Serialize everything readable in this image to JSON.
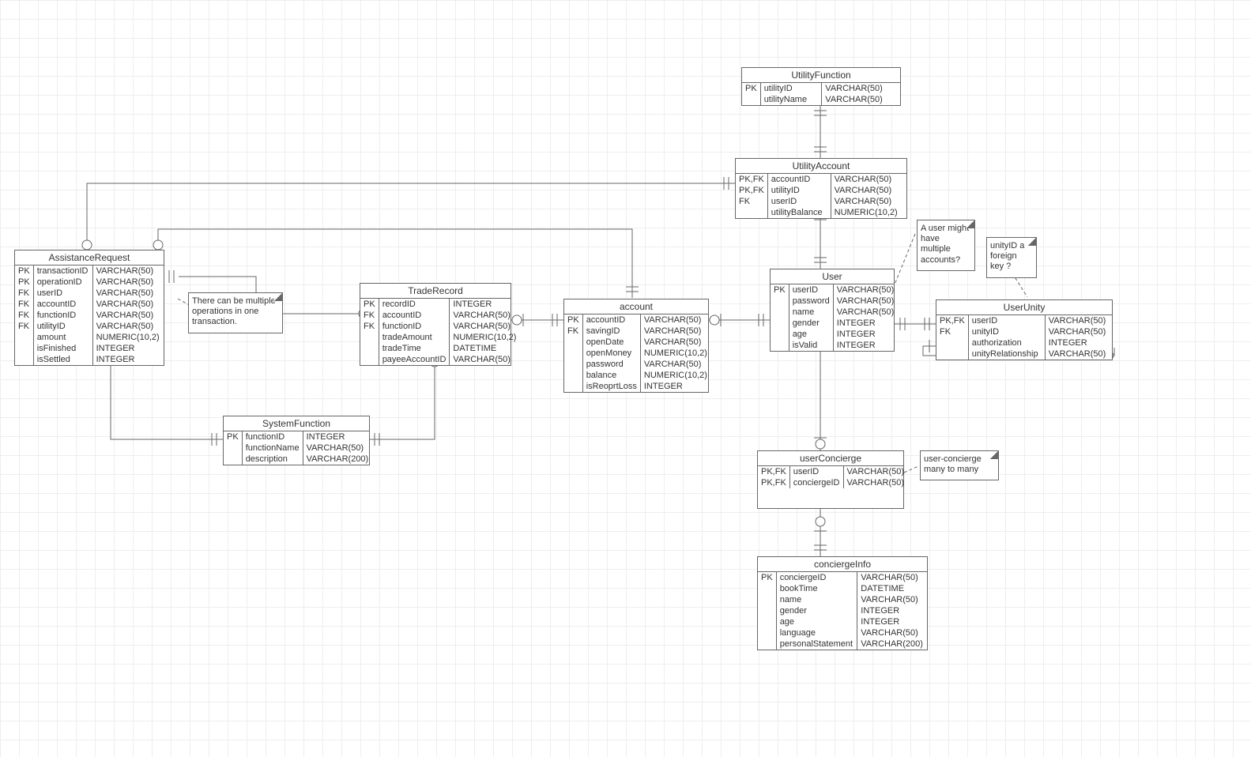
{
  "entities": {
    "utilityFunction": {
      "title": "UtilityFunction",
      "rows": [
        {
          "k": "PK",
          "f": "utilityID",
          "t": "VARCHAR(50)"
        },
        {
          "k": "",
          "f": "utilityName",
          "t": "VARCHAR(50)"
        }
      ]
    },
    "utilityAccount": {
      "title": "UtilityAccount",
      "rows": [
        {
          "k": "PK,FK",
          "f": "accountID",
          "t": "VARCHAR(50)"
        },
        {
          "k": "PK,FK",
          "f": "utilityID",
          "t": "VARCHAR(50)"
        },
        {
          "k": "FK",
          "f": "userID",
          "t": "VARCHAR(50)"
        },
        {
          "k": "",
          "f": "utilityBalance",
          "t": "NUMERIC(10,2)"
        }
      ]
    },
    "user": {
      "title": "User",
      "rows": [
        {
          "k": "PK",
          "f": "userID",
          "t": "VARCHAR(50)"
        },
        {
          "k": "",
          "f": "password",
          "t": "VARCHAR(50)"
        },
        {
          "k": "",
          "f": "name",
          "t": "VARCHAR(50)"
        },
        {
          "k": "",
          "f": "gender",
          "t": "INTEGER"
        },
        {
          "k": "",
          "f": "age",
          "t": "INTEGER"
        },
        {
          "k": "",
          "f": "isValid",
          "t": "INTEGER"
        }
      ]
    },
    "userUnity": {
      "title": "UserUnity",
      "rows": [
        {
          "k": "PK,FK",
          "f": "userID",
          "t": "VARCHAR(50)"
        },
        {
          "k": "FK",
          "f": "unityID",
          "t": "VARCHAR(50)"
        },
        {
          "k": "",
          "f": "authorization",
          "t": "INTEGER"
        },
        {
          "k": "",
          "f": "unityRelationship",
          "t": "VARCHAR(50)"
        }
      ]
    },
    "account": {
      "title": "account",
      "rows": [
        {
          "k": "PK",
          "f": "accountID",
          "t": "VARCHAR(50)"
        },
        {
          "k": "FK",
          "f": "savingID",
          "t": "VARCHAR(50)"
        },
        {
          "k": "",
          "f": "openDate",
          "t": "VARCHAR(50)"
        },
        {
          "k": "",
          "f": "openMoney",
          "t": "NUMERIC(10,2)"
        },
        {
          "k": "",
          "f": "password",
          "t": "VARCHAR(50)"
        },
        {
          "k": "",
          "f": "balance",
          "t": "NUMERIC(10,2)"
        },
        {
          "k": "",
          "f": "isReoprtLoss",
          "t": "INTEGER"
        }
      ]
    },
    "tradeRecord": {
      "title": "TradeRecord",
      "rows": [
        {
          "k": "PK",
          "f": "recordID",
          "t": "INTEGER"
        },
        {
          "k": "FK",
          "f": "accountID",
          "t": "VARCHAR(50)"
        },
        {
          "k": "FK",
          "f": "functionID",
          "t": "VARCHAR(50)"
        },
        {
          "k": "",
          "f": "tradeAmount",
          "t": "NUMERIC(10,2)"
        },
        {
          "k": "",
          "f": "tradeTime",
          "t": "DATETIME"
        },
        {
          "k": "",
          "f": "payeeAccountID",
          "t": "VARCHAR(50)"
        }
      ]
    },
    "assistanceRequest": {
      "title": "AssistanceRequest",
      "rows": [
        {
          "k": "PK",
          "f": "transactionID",
          "t": "VARCHAR(50)"
        },
        {
          "k": "PK",
          "f": "operationID",
          "t": "VARCHAR(50)"
        },
        {
          "k": "FK",
          "f": "userID",
          "t": "VARCHAR(50)"
        },
        {
          "k": "FK",
          "f": "accountID",
          "t": "VARCHAR(50)"
        },
        {
          "k": "FK",
          "f": "functionID",
          "t": "VARCHAR(50)"
        },
        {
          "k": "FK",
          "f": "utilityID",
          "t": "VARCHAR(50)"
        },
        {
          "k": "",
          "f": "amount",
          "t": "NUMERIC(10,2)"
        },
        {
          "k": "",
          "f": "isFinished",
          "t": "INTEGER"
        },
        {
          "k": "",
          "f": "isSettled",
          "t": "INTEGER"
        }
      ]
    },
    "systemFunction": {
      "title": "SystemFunction",
      "rows": [
        {
          "k": "PK",
          "f": "functionID",
          "t": "INTEGER"
        },
        {
          "k": "",
          "f": "functionName",
          "t": "VARCHAR(50)"
        },
        {
          "k": "",
          "f": "description",
          "t": "VARCHAR(200)"
        }
      ]
    },
    "userConcierge": {
      "title": "userConcierge",
      "rows": [
        {
          "k": "PK,FK",
          "f": "userID",
          "t": "VARCHAR(50)"
        },
        {
          "k": "PK,FK",
          "f": "conciergeID",
          "t": "VARCHAR(50)"
        }
      ]
    },
    "conciergeInfo": {
      "title": "conciergeInfo",
      "rows": [
        {
          "k": "PK",
          "f": "conciergeID",
          "t": "VARCHAR(50)"
        },
        {
          "k": "",
          "f": "bookTime",
          "t": "DATETIME"
        },
        {
          "k": "",
          "f": "name",
          "t": "VARCHAR(50)"
        },
        {
          "k": "",
          "f": "gender",
          "t": "INTEGER"
        },
        {
          "k": "",
          "f": "age",
          "t": "INTEGER"
        },
        {
          "k": "",
          "f": "language",
          "t": "VARCHAR(50)"
        },
        {
          "k": "",
          "f": "personalStatement",
          "t": "VARCHAR(200)"
        }
      ]
    }
  },
  "notes": {
    "n1": "There can be multiple operations in one transaction.",
    "n2": "A user might have multiple accounts?",
    "n3": "unityID a foreign key ?",
    "n4": "user-concierge many to many"
  },
  "chart_data": {
    "type": "table",
    "diagram": "ER diagram",
    "relations": [
      {
        "from": "UtilityFunction",
        "to": "UtilityAccount"
      },
      {
        "from": "UtilityAccount",
        "to": "User"
      },
      {
        "from": "UtilityAccount",
        "to": "AssistanceRequest"
      },
      {
        "from": "User",
        "to": "account"
      },
      {
        "from": "User",
        "to": "UserUnity"
      },
      {
        "from": "UserUnity",
        "to": "UserUnity",
        "self": true
      },
      {
        "from": "User",
        "to": "userConcierge"
      },
      {
        "from": "userConcierge",
        "to": "conciergeInfo"
      },
      {
        "from": "account",
        "to": "TradeRecord"
      },
      {
        "from": "account",
        "to": "AssistanceRequest"
      },
      {
        "from": "TradeRecord",
        "to": "AssistanceRequest"
      },
      {
        "from": "SystemFunction",
        "to": "AssistanceRequest"
      },
      {
        "from": "SystemFunction",
        "to": "TradeRecord"
      }
    ]
  }
}
